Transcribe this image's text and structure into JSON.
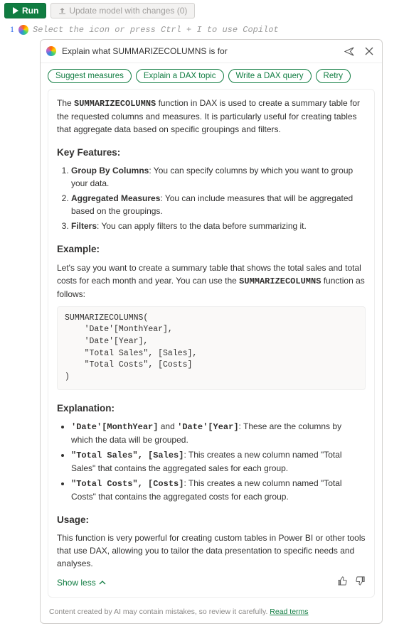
{
  "toolbar": {
    "run_label": "Run",
    "update_label": "Update model with changes (0)"
  },
  "editor": {
    "line_number": "1",
    "placeholder": "Select the icon or press Ctrl + I to use Copilot"
  },
  "copilot": {
    "title": "Explain what SUMMARIZECOLUMNS is for",
    "chips": [
      "Suggest measures",
      "Explain a DAX topic",
      "Write a DAX query",
      "Retry"
    ],
    "intro_pre": "The ",
    "intro_fn": "SUMMARIZECOLUMNS",
    "intro_post": " function in DAX is used to create a summary table for the requested columns and measures. It is particularly useful for creating tables that aggregate data based on specific groupings and filters.",
    "h_features": "Key Features:",
    "feat": [
      {
        "b": "Group By Columns",
        "t": ": You can specify columns by which you want to group your data."
      },
      {
        "b": "Aggregated Measures",
        "t": ": You can include measures that will be aggregated based on the groupings."
      },
      {
        "b": "Filters",
        "t": ": You can apply filters to the data before summarizing it."
      }
    ],
    "h_example": "Example:",
    "example_pre": "Let's say you want to create a summary table that shows the total sales and total costs for each month and year. You can use the ",
    "example_fn": "SUMMARIZECOLUMNS",
    "example_post": " function as follows:",
    "code": "SUMMARIZECOLUMNS(\n    'Date'[MonthYear],\n    'Date'[Year],\n    \"Total Sales\", [Sales],\n    \"Total Costs\", [Costs]\n)",
    "h_explain": "Explanation:",
    "explain": [
      {
        "c": "'Date'[MonthYear]",
        "mid": " and ",
        "c2": "'Date'[Year]",
        "t": ": These are the columns by which the data will be grouped."
      },
      {
        "c": "\"Total Sales\", [Sales]",
        "t": ": This creates a new column named \"Total Sales\" that contains the aggregated sales for each group."
      },
      {
        "c": "\"Total Costs\", [Costs]",
        "t": ": This creates a new column named \"Total Costs\" that contains the aggregated costs for each group."
      }
    ],
    "h_usage": "Usage:",
    "usage_text": "This function is very powerful for creating custom tables in Power BI or other tools that use DAX, allowing you to tailor the data presentation to specific needs and analyses.",
    "show_less": "Show less",
    "disclaimer_text": "Content created by AI may contain mistakes, so review it carefully. ",
    "disclaimer_link": "Read terms"
  }
}
